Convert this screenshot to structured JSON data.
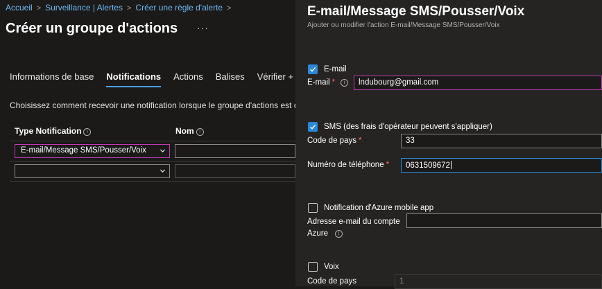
{
  "breadcrumb": [
    "Accueil",
    "Surveillance | Alertes",
    "Créer une règle d'alerte"
  ],
  "page": {
    "title": "Créer un groupe d'actions",
    "more": "···",
    "tabs": [
      "Informations de base",
      "Notifications",
      "Actions",
      "Balises",
      "Vérifier +"
    ],
    "active_tab": "Notifications",
    "description": "Choisissez comment recevoir une notification lorsque le groupe d'actions est dé",
    "columns": {
      "type": "Type Notification",
      "name": "Nom"
    },
    "rows": [
      {
        "type": "E-mail/Message SMS/Pousser/Voix",
        "name": ""
      },
      {
        "type": "",
        "name": ""
      }
    ]
  },
  "panel": {
    "title": "E-mail/Message SMS/Pousser/Voix",
    "subtitle": "Ajouter ou modifier l'action E-mail/Message SMS/Pousser/Voix",
    "email": {
      "checkbox_label": "E-mail",
      "checked": true,
      "field_label": "E-mail",
      "value": "lndubourg@gmail.com"
    },
    "sms": {
      "checkbox_label": "SMS (des frais d'opérateur peuvent s'appliquer)",
      "checked": true,
      "country_label": "Code de pays",
      "country_value": "33",
      "phone_label": "Numéro de téléphone",
      "phone_value": "0631509672"
    },
    "azure": {
      "checkbox_label": "Notification d'Azure mobile app",
      "checked": false,
      "field_label_1": "Adresse e-mail du compte",
      "field_label_2": "Azure",
      "value": ""
    },
    "voice": {
      "checkbox_label": "Voix",
      "checked": false,
      "country_label": "Code de pays",
      "country_value": "1"
    }
  },
  "colors": {
    "accent": "#2b88d8",
    "focus": "#c239b3",
    "link": "#6cb8f6",
    "required": "#ff6b6b"
  }
}
